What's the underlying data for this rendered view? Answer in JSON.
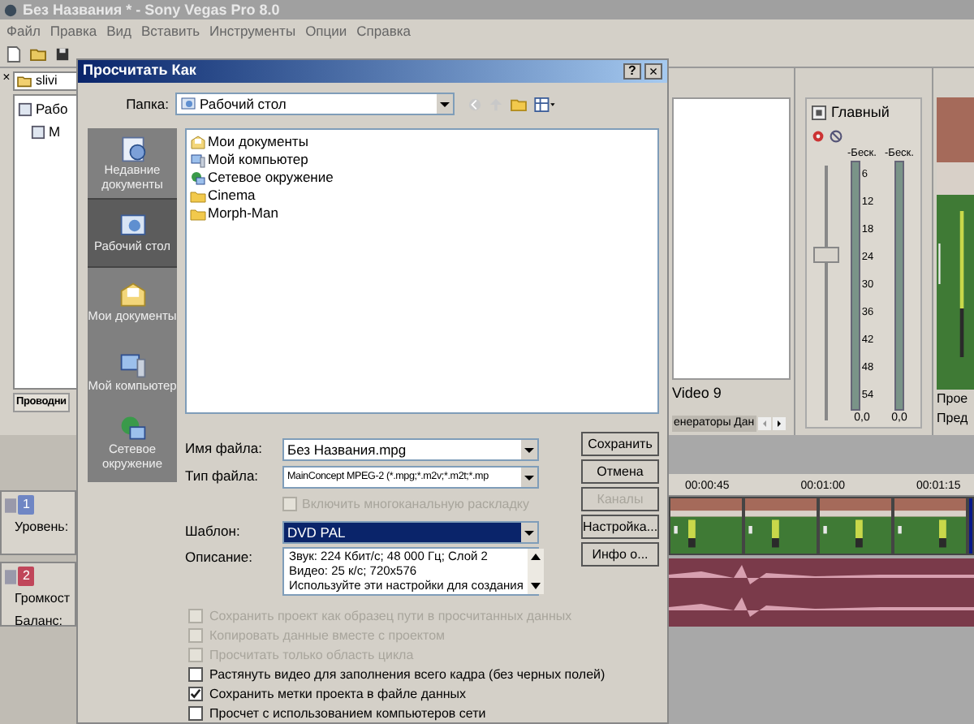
{
  "app": {
    "title": "Без Названия * - Sony Vegas Pro 8.0",
    "menu": [
      "Файл",
      "Правка",
      "Вид",
      "Вставить",
      "Инструменты",
      "Опции",
      "Справка"
    ]
  },
  "explorer": {
    "close": "×",
    "path": "slivi",
    "tree": [
      "Рабо",
      "М"
    ],
    "tab": "Проводни"
  },
  "tracks": [
    {
      "number": "1",
      "kind": "video",
      "color": "#6f86c4",
      "labels": [
        "Уровень:"
      ]
    },
    {
      "number": "2",
      "kind": "audio",
      "color": "#c0465a",
      "labels": [
        "Громкост",
        "Баланс:"
      ]
    }
  ],
  "media_pane": {
    "caption": "Video 9",
    "tab": "енераторы Дан"
  },
  "mixer": {
    "name": "Главный",
    "peaks": [
      "-Беск.",
      "-Беск."
    ],
    "ticks": [
      "6",
      "12",
      "18",
      "24",
      "30",
      "36",
      "42",
      "48",
      "54"
    ],
    "readings": [
      "0,0",
      "0,0"
    ],
    "fader": {
      "level": 0.68
    }
  },
  "preview": {
    "labels": [
      "Прое",
      "Пред"
    ]
  },
  "timeline": {
    "ticks": [
      "00:00:45",
      "00:01:00",
      "00:01:15"
    ]
  },
  "dialog": {
    "title": "Просчитать Как",
    "help": "?",
    "close": "×",
    "folder_label": "Папка:",
    "folder": "Рабочий стол",
    "places": [
      {
        "label": "Недавние документы",
        "kind": "recent",
        "selected": false
      },
      {
        "label": "Рабочий стол",
        "kind": "desktop",
        "selected": true
      },
      {
        "label": "Мои документы",
        "kind": "documents",
        "selected": false
      },
      {
        "label": "Мой компьютер",
        "kind": "computer",
        "selected": false
      },
      {
        "label": "Сетевое окружение",
        "kind": "network",
        "selected": false
      }
    ],
    "files": [
      {
        "name": "Мои документы",
        "kind": "documents"
      },
      {
        "name": "Мой компьютер",
        "kind": "computer"
      },
      {
        "name": "Сетевое окружение",
        "kind": "network"
      },
      {
        "name": "Cinema",
        "kind": "folder"
      },
      {
        "name": "Morph-Man",
        "kind": "folder"
      }
    ],
    "filename_label": "Имя файла:",
    "filename": "Без Названия.mpg",
    "filetype_label": "Тип файла:",
    "filetype": "MainConcept MPEG-2 (*.mpg;*.m2v;*.m2t;*.mp",
    "multichannel": {
      "label": "Включить многоканальную раскладку",
      "checked": false,
      "disabled": true
    },
    "template_label": "Шаблон:",
    "template": "DVD PAL",
    "description_label": "Описание:",
    "description": [
      "Звук: 224 Кбит/с; 48 000 Гц; Слой 2",
      "Видео: 25 к/с; 720x576",
      "Используйте эти настройки для создания"
    ],
    "buttons": [
      {
        "label": "Сохранить",
        "disabled": false
      },
      {
        "label": "Отмена",
        "disabled": false
      },
      {
        "label": "Каналы",
        "disabled": true
      },
      {
        "label": "Настройка...",
        "disabled": false
      },
      {
        "label": "Инфо о...",
        "disabled": false
      }
    ],
    "options": [
      {
        "label": "Сохранить проект как образец пути в просчитанных данных",
        "checked": false,
        "disabled": true
      },
      {
        "label": "Копировать данные вместе с проектом",
        "checked": false,
        "disabled": true
      },
      {
        "label": "Просчитать только область цикла",
        "checked": false,
        "disabled": true
      },
      {
        "label": "Растянуть видео для заполнения всего кадра (без черных полей)",
        "checked": false,
        "disabled": false
      },
      {
        "label": "Сохранить метки проекта в файле данных",
        "checked": true,
        "disabled": false
      },
      {
        "label": "Просчет с использованием компьютеров сети",
        "checked": false,
        "disabled": false
      }
    ]
  }
}
